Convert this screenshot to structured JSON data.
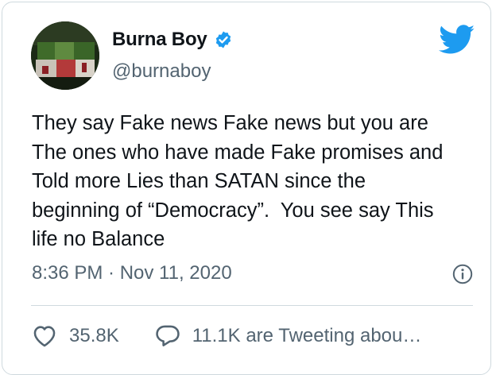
{
  "tweet": {
    "author": {
      "display_name": "Burna Boy",
      "handle": "@burnaboy",
      "verified": true,
      "avatar_icon": "profile-photo"
    },
    "text": "They say Fake news Fake news but you are\nThe ones who have made Fake promises and\nTold more Lies than SATAN since the\nbeginning of “Democracy”.  You see say This\nlife no Balance",
    "timestamp": "8:36 PM · Nov 11, 2020",
    "likes": "35.8K",
    "tweeting_about": "11.1K are Tweeting abou…"
  },
  "icons": {
    "brand": "twitter-bird-icon",
    "verified": "verified-badge-icon",
    "info": "info-icon",
    "like": "heart-icon",
    "reply": "speech-bubble-icon"
  },
  "colors": {
    "brand_blue": "#1d9bf0",
    "text_primary": "#0f1419",
    "text_secondary": "#536471",
    "border": "#cfd9de"
  }
}
